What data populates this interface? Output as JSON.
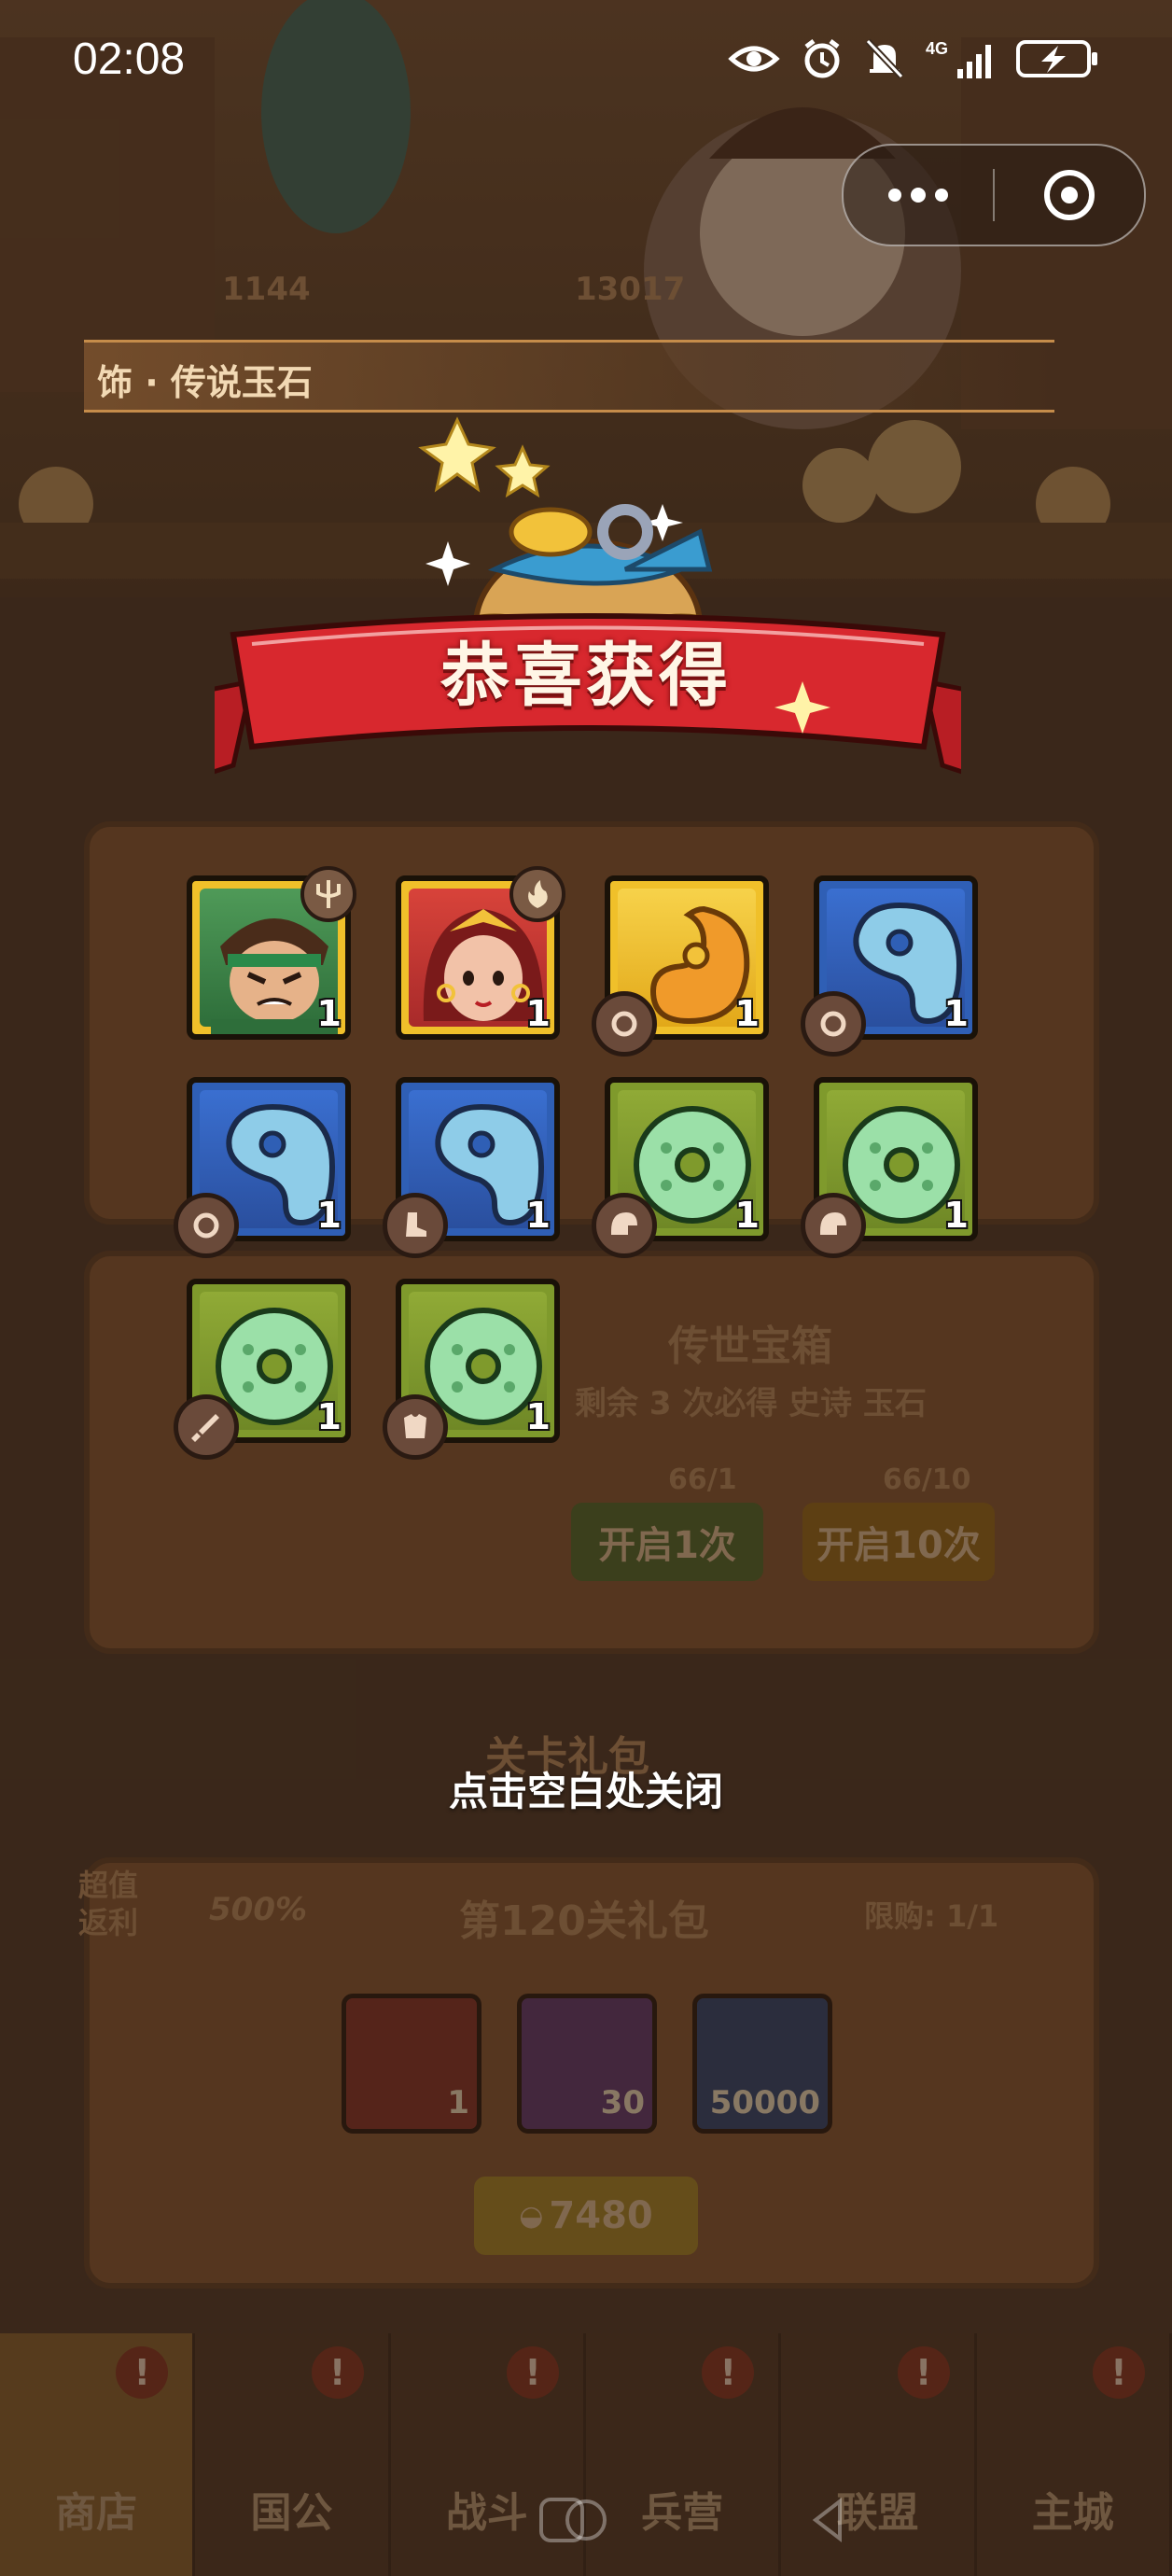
{
  "status_bar": {
    "time": "02:08",
    "network": "4G",
    "icons": [
      "eye-icon",
      "alarm-icon",
      "mute-icon",
      "signal-icon",
      "battery-charging-icon"
    ]
  },
  "capsule": {
    "more_icon": "more-dots-icon",
    "close_icon": "target-close-icon"
  },
  "background": {
    "currency_1": "1144",
    "currency_2": "13017",
    "banner_text": "饰 · 传说玉石",
    "chest_title": "传世宝箱",
    "chest_hint": "剩余 3 次必得 史诗 玉石",
    "key_count_1": "66/1",
    "key_count_2": "66/10",
    "open_once": "开启1次",
    "open_ten": "开启10次",
    "level_pack_section": "关卡礼包",
    "pack_tag_line1": "超值",
    "pack_tag_line2": "返利",
    "pack_percent": "500%",
    "pack_title": "第120关礼包",
    "pack_limit": "限购: 1/1",
    "pack_items": [
      {
        "qty": "1",
        "color": "#8a3a2a"
      },
      {
        "qty": "30",
        "color": "#6a3e6a"
      },
      {
        "qty": "50000",
        "color": "#3e4a6a"
      }
    ],
    "pack_price": "7480"
  },
  "popup": {
    "title": "恭喜获得",
    "close_hint": "点击空白处关闭",
    "rewards": [
      {
        "kind": "hero",
        "color": "gold",
        "qty": "1",
        "badge_icon": "trident-icon"
      },
      {
        "kind": "hero",
        "color": "gold",
        "qty": "1",
        "badge_icon": "fire-icon"
      },
      {
        "kind": "jade-comma",
        "color": "gold",
        "qty": "1",
        "badge_icon": "ring-icon"
      },
      {
        "kind": "jade-comma",
        "color": "blue",
        "qty": "1",
        "badge_icon": "ring-icon"
      },
      {
        "kind": "jade-comma",
        "color": "blue",
        "qty": "1",
        "badge_icon": "ring-icon"
      },
      {
        "kind": "jade-comma",
        "color": "blue",
        "qty": "1",
        "badge_icon": "boot-icon"
      },
      {
        "kind": "jade-disc",
        "color": "green",
        "qty": "1",
        "badge_icon": "helmet-icon"
      },
      {
        "kind": "jade-disc",
        "color": "green",
        "qty": "1",
        "badge_icon": "helmet-icon"
      },
      {
        "kind": "jade-disc",
        "color": "green",
        "qty": "1",
        "badge_icon": "sword-icon"
      },
      {
        "kind": "jade-disc",
        "color": "green",
        "qty": "1",
        "badge_icon": "armor-icon"
      }
    ]
  },
  "bottom_nav": [
    {
      "label": "商店",
      "active": true,
      "badge": "!"
    },
    {
      "label": "国公",
      "active": false,
      "badge": "!"
    },
    {
      "label": "战斗",
      "active": false,
      "badge": "!"
    },
    {
      "label": "兵营",
      "active": false,
      "badge": "!"
    },
    {
      "label": "联盟",
      "active": false,
      "badge": "!"
    },
    {
      "label": "主城",
      "active": false,
      "badge": "!"
    }
  ]
}
